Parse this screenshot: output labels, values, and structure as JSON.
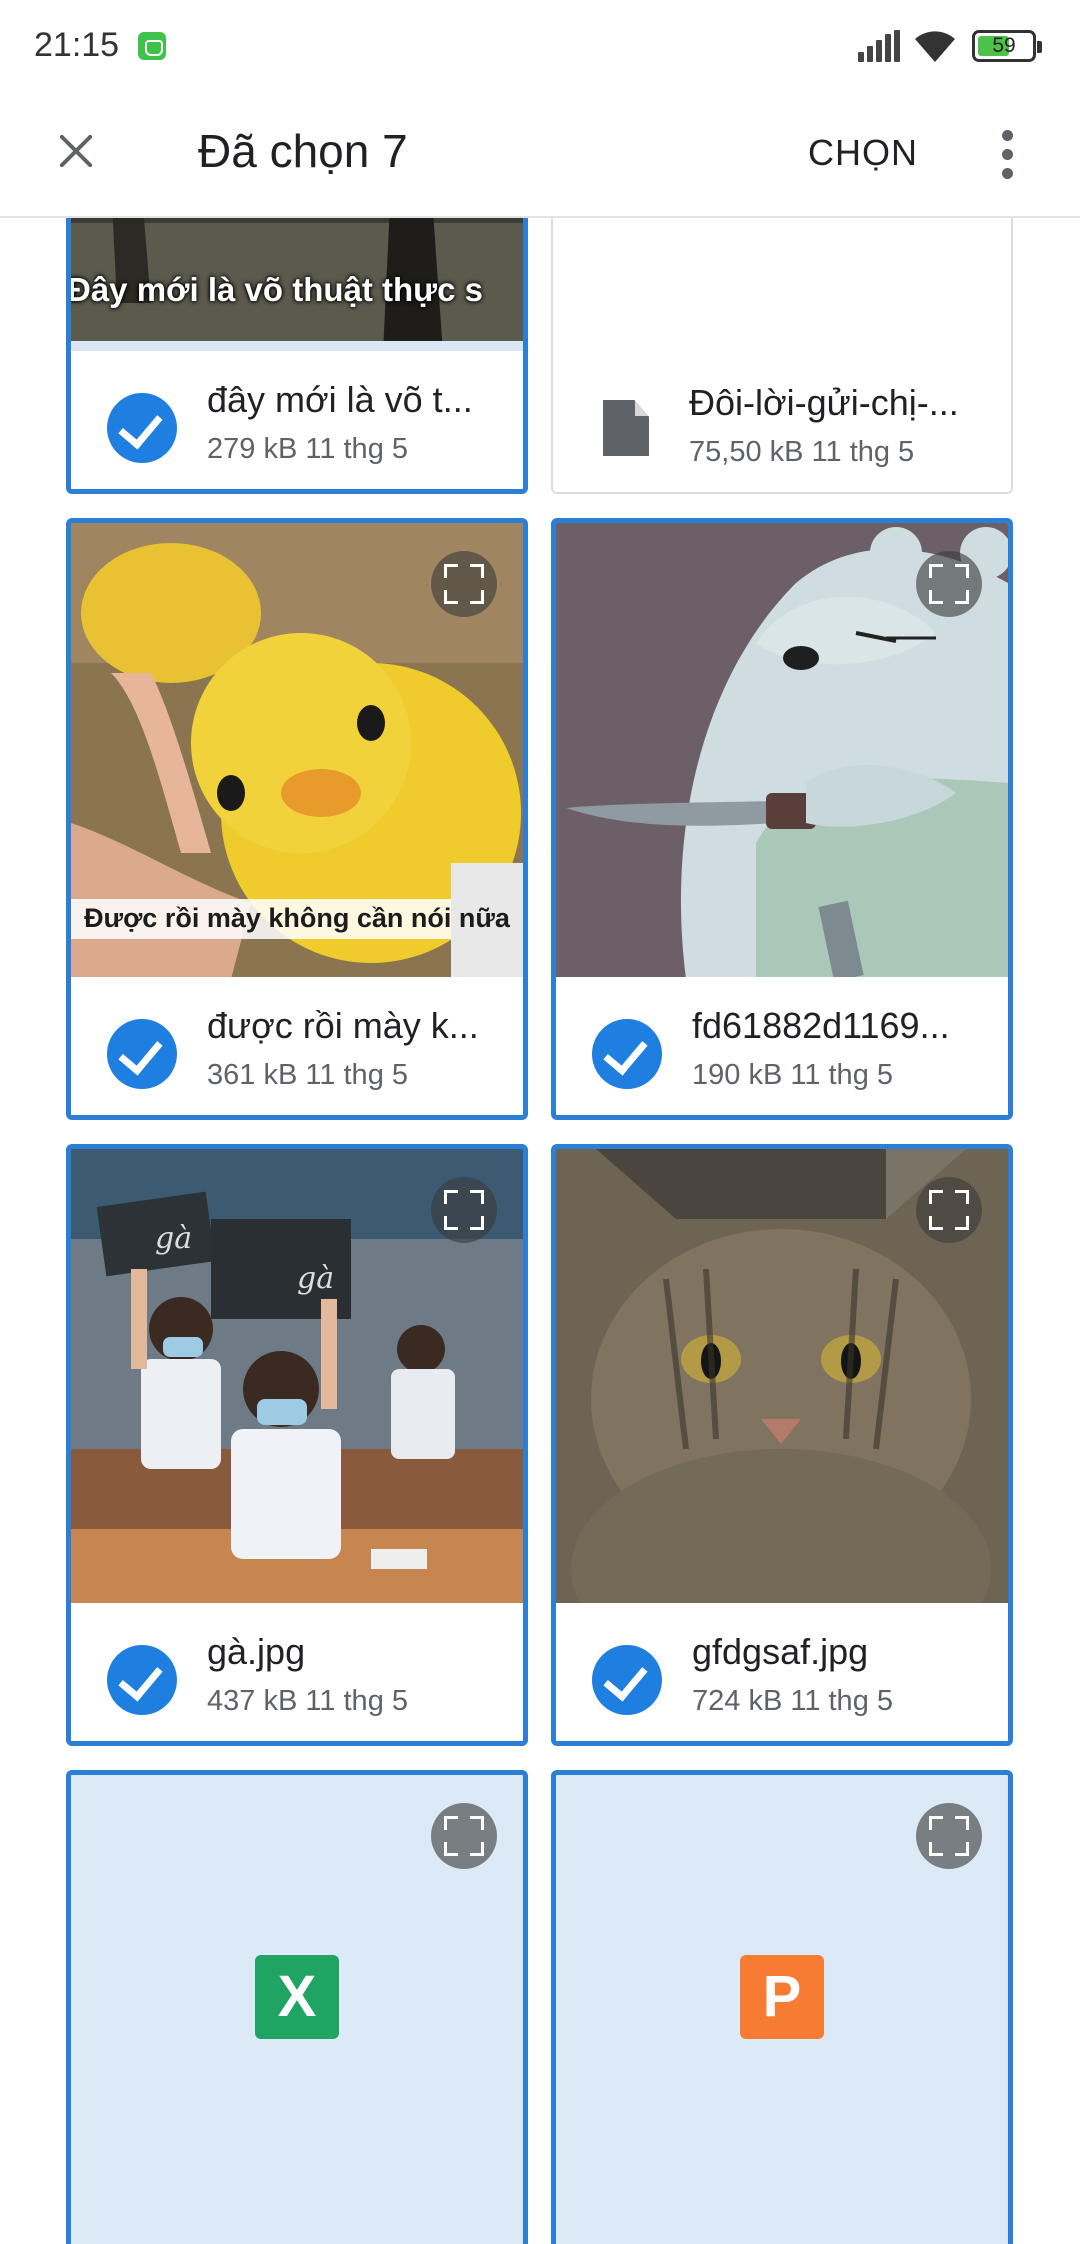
{
  "status_bar": {
    "time": "21:15",
    "battery_level": "59",
    "battery_fraction": 0.59
  },
  "app_bar": {
    "title": "Đã chọn 7",
    "select_label": "CHỌN"
  },
  "files": [
    {
      "name": "đây mới là võ t...",
      "meta": "279 kB  11 thg 5",
      "selected": true,
      "thumb_caption": "Đây mới là võ thuật thực s"
    },
    {
      "name": "Đôi-lời-gửi-chị-...",
      "meta": "75,50 kB  11 thg 5",
      "selected": false,
      "icon": "document-icon"
    },
    {
      "name": "được rồi mày k...",
      "meta": "361 kB  11 thg 5",
      "selected": true,
      "thumb_caption": "Được rồi mày không cần nói nữa"
    },
    {
      "name": "fd61882d1169...",
      "meta": "190 kB  11 thg 5",
      "selected": true
    },
    {
      "name": "gà.jpg",
      "meta": "437 kB  11 thg 5",
      "selected": true,
      "thumb_text_1": "gà",
      "thumb_text_2": "gà"
    },
    {
      "name": "gfdgsaf.jpg",
      "meta": "724 kB  11 thg 5",
      "selected": true
    },
    {
      "name": "",
      "meta": "",
      "selected": true,
      "icon_letter": "X",
      "icon": "excel-icon"
    },
    {
      "name": "",
      "meta": "",
      "selected": true,
      "icon_letter": "P",
      "icon": "powerpoint-icon"
    }
  ],
  "colors": {
    "selection_border": "#2b7fd4",
    "check": "#1f7fe0",
    "excel": "#1fa463",
    "powerpoint": "#f57c32",
    "office_thumb_bg": "#dce9f7"
  }
}
